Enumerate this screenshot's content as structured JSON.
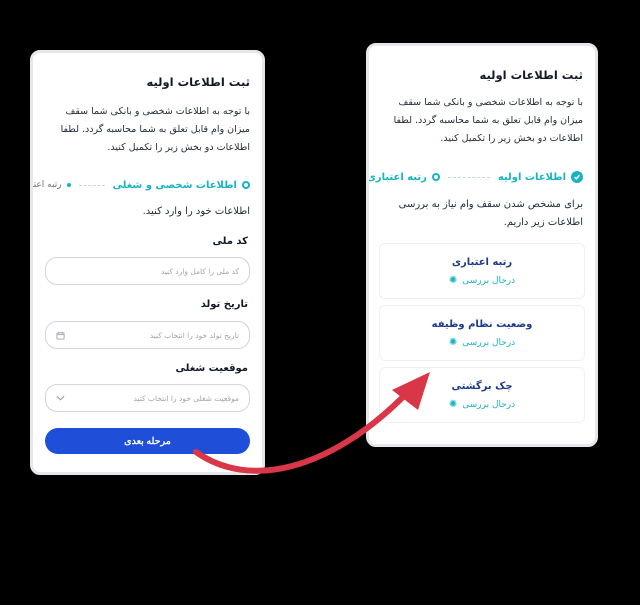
{
  "left": {
    "title": "ثبت اطلاعات اولیه",
    "desc": "با توجه به اطلاعات شخصی  و بانکی شما سقف میزان وام قابل تعلق به شما محاسبه گردد. لطفا اطلاعات دو بخش زیر را تکمیل کنید.",
    "step_active": "اطلاعات شخصی و شغلی",
    "step_next": "رتبه اعتباری",
    "intro": "اطلاعات خود را وارد کنید.",
    "fields": [
      {
        "label": "کد ملی",
        "placeholder": "کد ملی را کامل وارد کنید"
      },
      {
        "label": "تاریخ تولد",
        "placeholder": "تاریخ تولد خود را انتخاب کنید"
      },
      {
        "label": "موقعیت شغلی",
        "placeholder": "موقعیت شغلی خود را انتخاب کنید"
      }
    ],
    "next_button": "مرحله بعدی"
  },
  "right": {
    "title": "ثبت اطلاعات اولیه",
    "desc": "با توجه به اطلاعات شخصی  و بانکی شما سقف میزان وام قابل تعلق به شما محاسبه گردد. لطفا اطلاعات دو بخش زیر را تکمیل کنید.",
    "step_done": "اطلاعات اولیه",
    "step_current": "رتبه اعتباری",
    "intro": "برای مشخص شدن سقف وام نیاز به بررسی اطلاعات زیر داریم.",
    "checks": [
      {
        "title": "رتبه اعتباری",
        "status": "درحال بررسی"
      },
      {
        "title": "وضعیت نظام وظیفه",
        "status": "درحال بررسی"
      },
      {
        "title": "چک برگشتی",
        "status": "درحال بررسی"
      }
    ]
  },
  "colors": {
    "accent": "#17b3c1",
    "primary_button": "#1f4fd8",
    "arrow": "#d93647"
  },
  "icons": [
    "check-circle-icon",
    "calendar-icon",
    "chevron-down-icon",
    "spinner-icon",
    "curved-arrow-icon"
  ]
}
